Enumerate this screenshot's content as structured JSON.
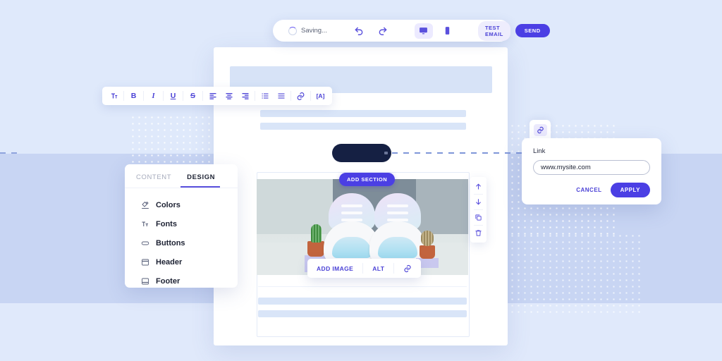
{
  "top_toolbar": {
    "status_text": "Saving...",
    "undo_label": "undo",
    "redo_label": "redo",
    "desktop_label": "desktop-view",
    "mobile_label": "mobile-view",
    "test_email_label": "TEST EMAIL",
    "send_label": "SEND"
  },
  "format_toolbar": {
    "items": [
      {
        "name": "text-style-icon",
        "glyph": "ᴛ"
      },
      {
        "name": "bold-icon",
        "glyph": "B"
      },
      {
        "name": "italic-icon",
        "glyph": "I"
      },
      {
        "name": "underline-icon",
        "glyph": "U"
      },
      {
        "name": "strikethrough-icon",
        "glyph": "S"
      },
      {
        "name": "align-left-icon",
        "glyph": ""
      },
      {
        "name": "align-center-icon",
        "glyph": ""
      },
      {
        "name": "align-right-icon",
        "glyph": ""
      },
      {
        "name": "ordered-list-icon",
        "glyph": ""
      },
      {
        "name": "bullet-list-icon",
        "glyph": ""
      },
      {
        "name": "link-icon",
        "glyph": ""
      },
      {
        "name": "merge-tag-icon",
        "glyph": "[A]"
      }
    ]
  },
  "design_panel": {
    "tabs": [
      {
        "label": "CONTENT",
        "active": false
      },
      {
        "label": "DESIGN",
        "active": true
      }
    ],
    "items": [
      {
        "label": "Colors",
        "icon": "color-picker-icon"
      },
      {
        "label": "Fonts",
        "icon": "font-icon"
      },
      {
        "label": "Buttons",
        "icon": "button-icon"
      },
      {
        "label": "Header",
        "icon": "header-icon"
      },
      {
        "label": "Footer",
        "icon": "footer-icon"
      }
    ]
  },
  "canvas": {
    "add_section_label": "ADD SECTION",
    "image_alt": "white iridescent sneakers between two potted cactus plants"
  },
  "image_toolbar": {
    "add_image_label": "ADD IMAGE",
    "alt_label": "ALT",
    "link_icon_name": "link-icon"
  },
  "block_tools": [
    {
      "name": "move-up-icon"
    },
    {
      "name": "move-down-icon"
    },
    {
      "name": "duplicate-icon"
    },
    {
      "name": "delete-icon"
    }
  ],
  "link_popup": {
    "tab_icon": "link-icon",
    "label": "Link",
    "value": "www.mysite.com",
    "placeholder": "www.mysite.com",
    "cancel_label": "CANCEL",
    "apply_label": "APPLY"
  },
  "colors": {
    "accent": "#4b3fe4",
    "accent_soft": "#eeedfd",
    "background_top": "#dfe9fb",
    "background_mid": "#c8d5f3",
    "dark_pill": "#152043",
    "placeholder_bar": "#d9e5f8"
  }
}
